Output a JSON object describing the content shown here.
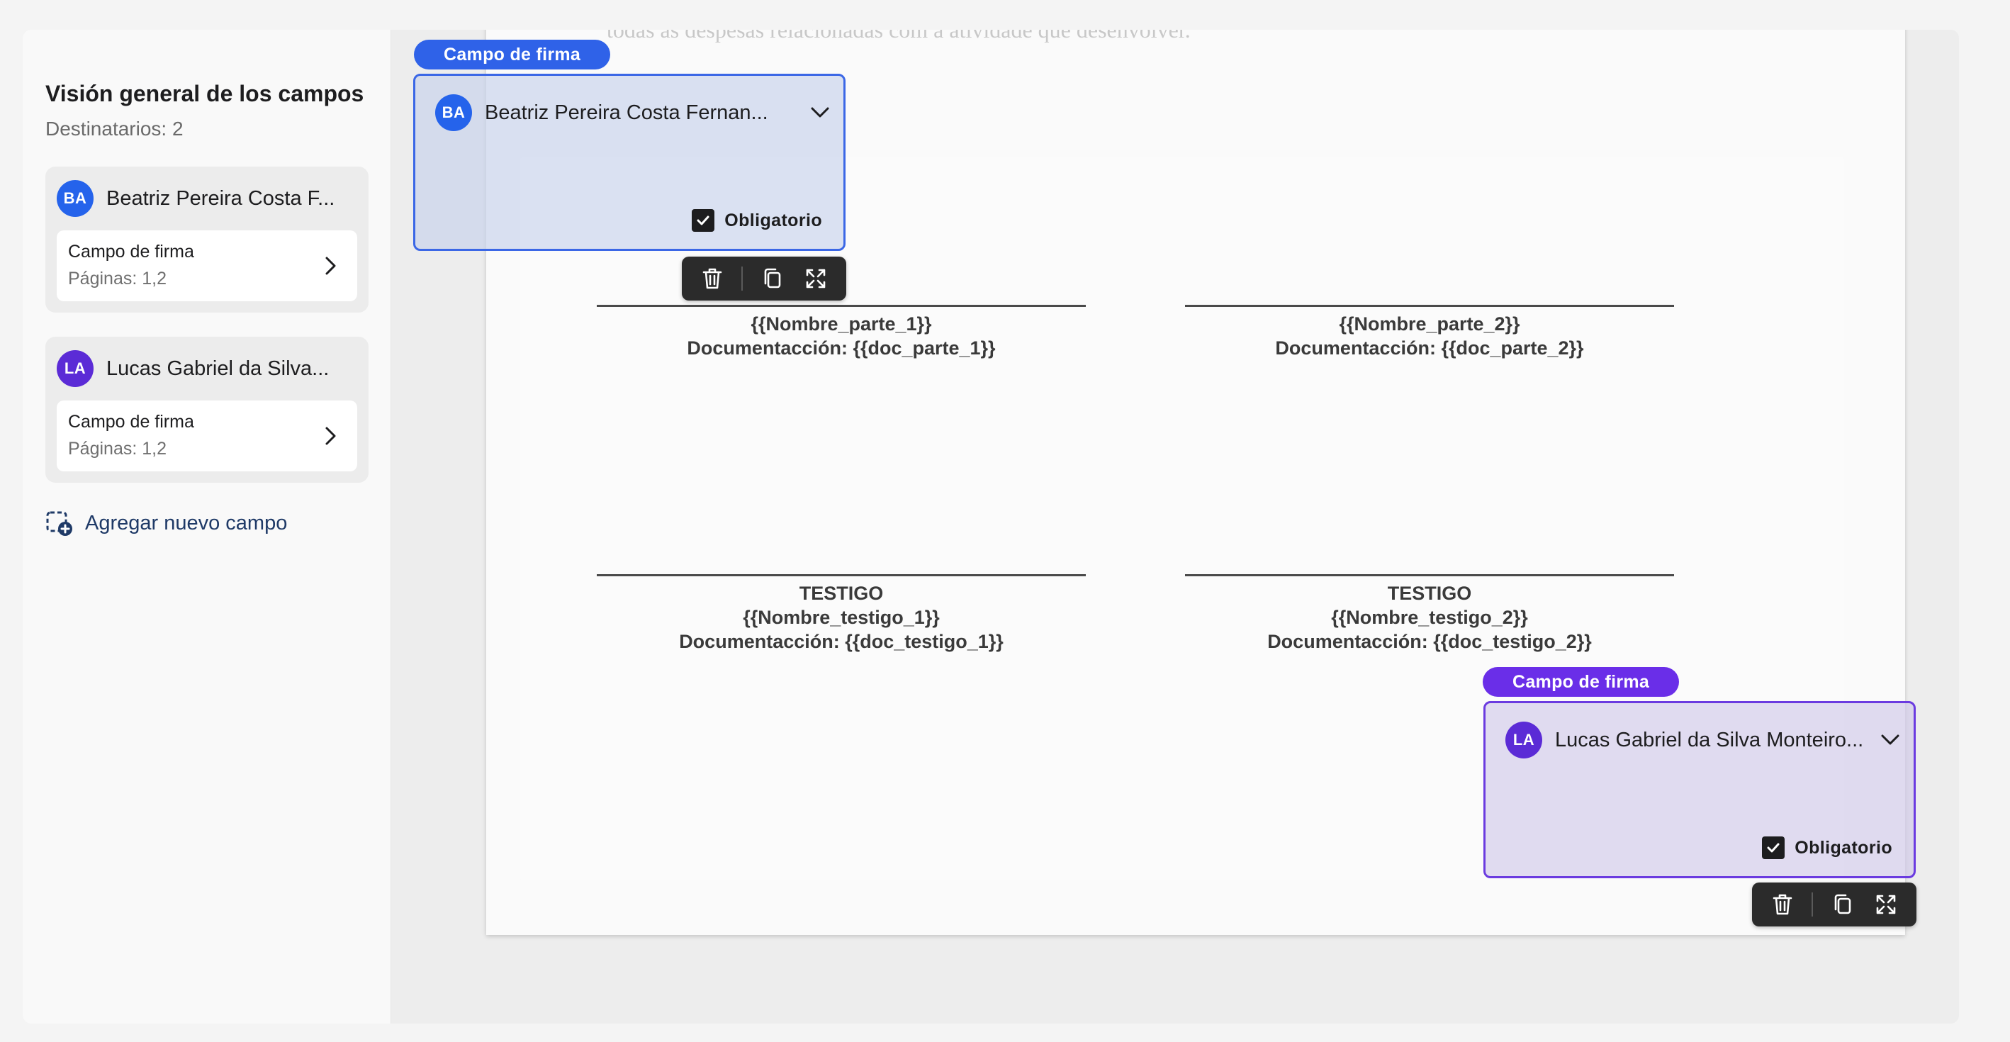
{
  "sidebar": {
    "title": "Visión general de los campos",
    "recipients_count": "Destinatarios: 2",
    "recipients": [
      {
        "initials": "BA",
        "name": "Beatriz Pereira Costa F...",
        "field": {
          "label": "Campo de firma",
          "pages": "Páginas: 1,2"
        }
      },
      {
        "initials": "LA",
        "name": "Lucas Gabriel da Silva...",
        "field": {
          "label": "Campo de firma",
          "pages": "Páginas: 1,2"
        }
      }
    ],
    "add_field_label": "Agregar nuevo campo"
  },
  "document": {
    "faded_top_text": "todas as despesas relacionadas com a atividade que desenvolver.",
    "signatures": [
      {
        "lines": [
          "{{Nombre_parte_1}}",
          "Documentacción: {{doc_parte_1}}"
        ]
      },
      {
        "lines": [
          "{{Nombre_parte_2}}",
          "Documentacción: {{doc_parte_2}}"
        ]
      },
      {
        "lines": [
          "TESTIGO",
          "{{Nombre_testigo_1}}",
          "Documentacción: {{doc_testigo_1}}"
        ]
      },
      {
        "lines": [
          "TESTIGO",
          "{{Nombre_testigo_2}}",
          "Documentacción: {{doc_testigo_2}}"
        ]
      }
    ]
  },
  "signature_fields": [
    {
      "tag_label": "Campo de firma",
      "initials": "BA",
      "recipient": "Beatriz Pereira Costa Fernan...",
      "required_label": "Obligatorio",
      "required": true,
      "color": "#2f62e8"
    },
    {
      "tag_label": "Campo de firma",
      "initials": "LA",
      "recipient": "Lucas Gabriel da Silva Monteiro...",
      "required_label": "Obligatorio",
      "required": true,
      "color": "#6a2ee8"
    }
  ],
  "toolbar_icons": [
    "trash-icon",
    "copy-icon",
    "expand-icon"
  ]
}
